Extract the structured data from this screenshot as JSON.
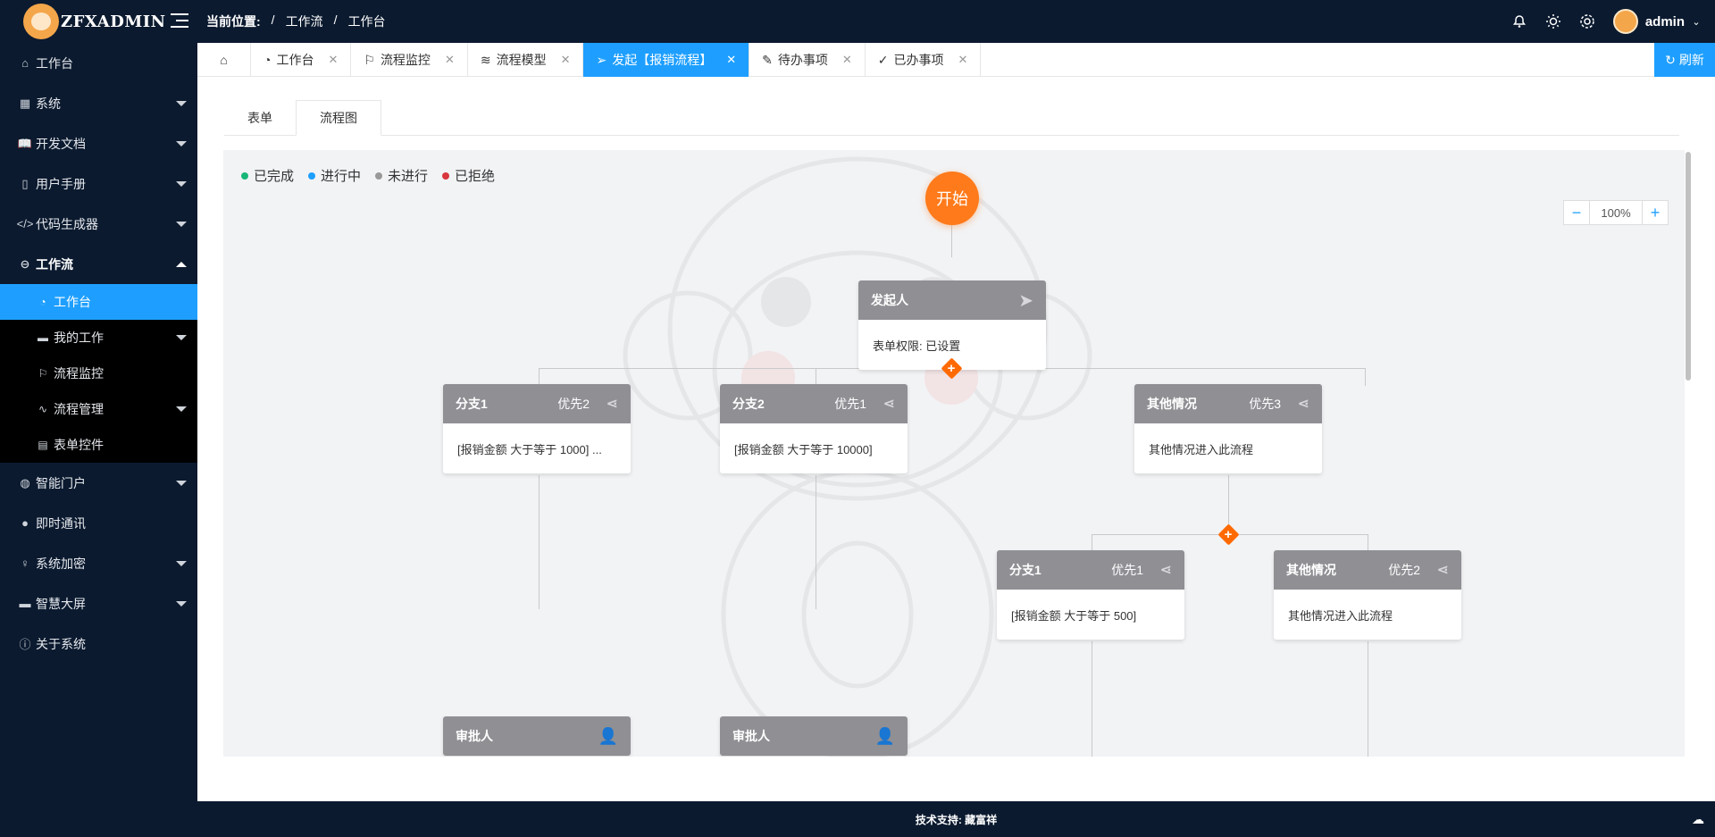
{
  "app": {
    "name": "ZFXADMIN"
  },
  "header": {
    "breadcrumb_label": "当前位置:",
    "breadcrumb": [
      "/",
      "工作流",
      "/",
      "工作台"
    ],
    "user": "admin"
  },
  "sidebar": {
    "items": [
      {
        "label": "工作台",
        "icon": "home-icon"
      },
      {
        "label": "系统",
        "icon": "grid-icon"
      },
      {
        "label": "开发文档",
        "icon": "book-icon"
      },
      {
        "label": "用户手册",
        "icon": "manual-icon"
      },
      {
        "label": "代码生成器",
        "icon": "code-icon"
      },
      {
        "label": "工作流",
        "icon": "workflow-icon"
      },
      {
        "label": "智能门户",
        "icon": "globe-icon"
      },
      {
        "label": "即时通讯",
        "icon": "chat-icon"
      },
      {
        "label": "系统加密",
        "icon": "key-icon"
      },
      {
        "label": "智慧大屏",
        "icon": "screen-icon"
      },
      {
        "label": "关于系统",
        "icon": "info-icon"
      }
    ],
    "workflow_sub": [
      {
        "label": "工作台",
        "icon": "dashboard-icon"
      },
      {
        "label": "我的工作",
        "icon": "monitor-icon"
      },
      {
        "label": "流程监控",
        "icon": "flag-icon"
      },
      {
        "label": "流程管理",
        "icon": "pulse-icon"
      },
      {
        "label": "表单控件",
        "icon": "form-icon"
      }
    ]
  },
  "tabs": [
    {
      "label": "工作台",
      "icon": "dashboard-icon"
    },
    {
      "label": "流程监控",
      "icon": "flag-icon"
    },
    {
      "label": "流程模型",
      "icon": "layers-icon"
    },
    {
      "label": "发起【报销流程】",
      "icon": "send-icon"
    },
    {
      "label": "待办事项",
      "icon": "edit-icon"
    },
    {
      "label": "已办事项",
      "icon": "check-icon"
    }
  ],
  "refresh_label": "刷新",
  "subtabs": [
    "表单",
    "流程图"
  ],
  "legend": [
    {
      "label": "已完成",
      "color": "#16b777"
    },
    {
      "label": "进行中",
      "color": "#1e9fff"
    },
    {
      "label": "未进行",
      "color": "#999999"
    },
    {
      "label": "已拒绝",
      "color": "#d9363e"
    }
  ],
  "zoom": {
    "minus": "−",
    "value": "100%",
    "plus": "+"
  },
  "flow": {
    "start": "开始",
    "initiator": {
      "title": "发起人",
      "body": "表单权限: 已设置"
    },
    "branches": [
      {
        "title": "分支1",
        "prio": "优先2",
        "body": "[报销金额 大于等于 1000] ..."
      },
      {
        "title": "分支2",
        "prio": "优先1",
        "body": "[报销金额 大于等于 10000]"
      },
      {
        "title": "其他情况",
        "prio": "优先3",
        "body": "其他情况进入此流程"
      }
    ],
    "sub_branches": [
      {
        "title": "分支1",
        "prio": "优先1",
        "body": "[报销金额 大于等于 500]"
      },
      {
        "title": "其他情况",
        "prio": "优先2",
        "body": "其他情况进入此流程"
      }
    ],
    "approvers": [
      {
        "title": "审批人"
      },
      {
        "title": "审批人"
      }
    ]
  },
  "footer": {
    "text": "技术支持: 藏富祥"
  }
}
